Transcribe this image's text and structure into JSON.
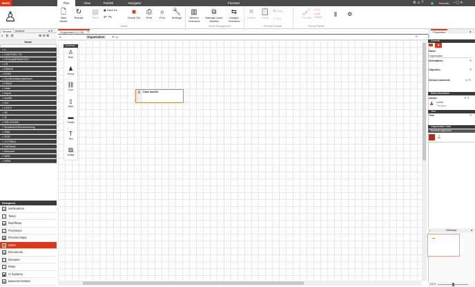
{
  "title_bar": {
    "menu": "Menu",
    "tabs": [
      "Plan",
      "View",
      "Publish",
      "Navigator"
    ],
    "app_name": "FireStart",
    "user": "Execute"
  },
  "ribbon": {
    "buttons": {
      "new_model": "New Model",
      "reload": "Reload",
      "save": "Save",
      "save_as": "Save As",
      "check_out": "Check Out",
      "print": "Print",
      "find": "Find",
      "settings": "Settings",
      "version_overview": "Version Overview",
      "manage_used_models": "Manage Used Models",
      "usages_overview": "Usages Overview",
      "delete": "Delete",
      "paste": "Paste",
      "copy": "Copy",
      "cut": "Cut",
      "format": "Format",
      "font": "Font",
      "color": "Color",
      "shape": "Shape"
    },
    "groups": {
      "model": "Model",
      "model_management": "Model Management",
      "selection_details": "Selection Details",
      "format_painter": "Format Painter"
    }
  },
  "left": {
    "tabs": [
      "Models",
      "Archive"
    ],
    "column_header": "Name",
    "rows": [
      "#",
      "CONTOSO LTD",
      "CP/Sw@BPM&E/2637",
      "CR",
      "DEMOS",
      "FERG",
      "Gesellschaftsprojektraum",
      "HR&M",
      "Heller",
      "Import",
      "Isobilla",
      "ISU",
      "LINCO",
      "SE",
      "SI",
      "SOLUTIONS",
      "Sprachsicht Berücksichtung",
      "SWA",
      "TEST",
      "TUTORIAL",
      "UseCases",
      "Wizzcard",
      "WKD",
      "WRM"
    ],
    "designers_header": "Designers",
    "designers": [
      {
        "label": "Notifications",
        "icon": "✉"
      },
      {
        "label": "Tasks",
        "icon": "✓"
      },
      {
        "label": "Workflows",
        "icon": "⇄"
      },
      {
        "label": "Processes",
        "icon": "▭"
      },
      {
        "label": "Process Maps",
        "icon": "▦"
      },
      {
        "label": "Roles",
        "icon": "♙"
      },
      {
        "label": "Documents",
        "icon": "▤"
      },
      {
        "label": "Domains",
        "icon": "◫"
      },
      {
        "label": "Risks",
        "icon": "⚠"
      },
      {
        "label": "IT Systems",
        "icon": "▣"
      },
      {
        "label": "Business Entities",
        "icon": "▥"
      }
    ],
    "active_designer": "Roles"
  },
  "canvas": {
    "document_tab": "Organization (1.00)",
    "breadcrumb": "Organization",
    "palette_header": "Common",
    "palette": [
      {
        "label": "Role",
        "icon": "♙"
      },
      {
        "label": "Group",
        "icon": "♟"
      },
      {
        "label": "Link",
        "icon": "⛓"
      },
      {
        "label": "Note",
        "icon": "▯"
      },
      {
        "label": "Shape",
        "icon": "▬"
      },
      {
        "label": "Text",
        "icon": "T"
      },
      {
        "label": "Image",
        "icon": "▨"
      }
    ],
    "node_label": "Case worker"
  },
  "properties": {
    "tab": "Properties",
    "sections": {
      "general": "General",
      "meta": "Meta-information",
      "text": "Text",
      "org_chart": "Organization chart",
      "alignment": "Element alignment"
    },
    "name_label": "Name",
    "name_value": "Organization",
    "description_label": "Description:",
    "objective_label": "Objective:",
    "version_comment_label": "Version comment:",
    "owner_label": "Owner:",
    "owner_name": "Lorem",
    "owner_sub": "Täpuglyn",
    "text_label": "Text:"
  },
  "minimap": {
    "title": "Minimap",
    "zoom": "100%"
  }
}
